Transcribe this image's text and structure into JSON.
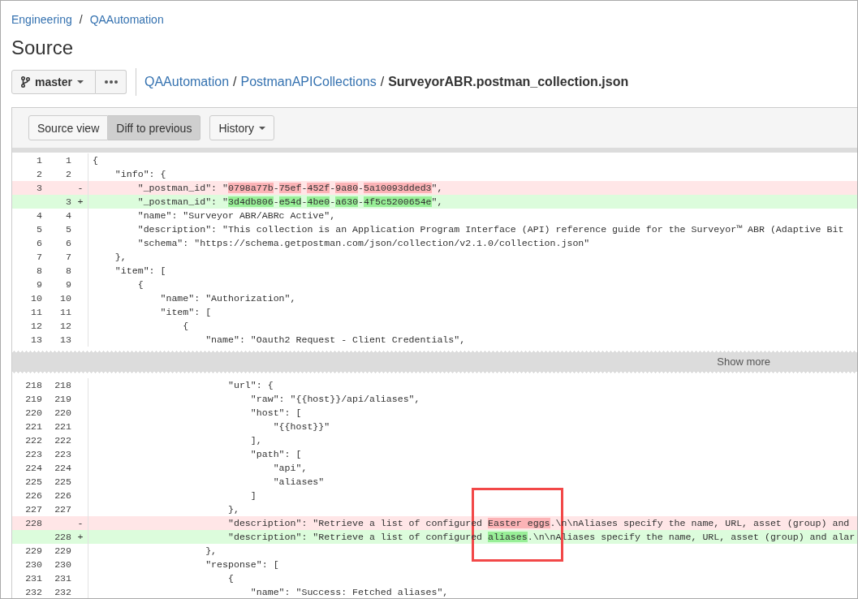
{
  "breadcrumbs": [
    {
      "kind": "link",
      "text": "Engineering"
    },
    {
      "kind": "separator",
      "text": "/"
    },
    {
      "kind": "link",
      "text": "QAAutomation"
    }
  ],
  "page_title": "Source",
  "branch_button": {
    "label": "master"
  },
  "file_path": [
    {
      "kind": "link",
      "text": "QAAutomation"
    },
    {
      "kind": "separator",
      "text": "/"
    },
    {
      "kind": "link",
      "text": "PostmanAPICollections"
    },
    {
      "kind": "separator",
      "text": "/"
    },
    {
      "kind": "current",
      "text": "SurveyorABR.postman_collection.json"
    }
  ],
  "view_toggle": [
    {
      "label": "Source view",
      "selected": false
    },
    {
      "label": "Diff to previous",
      "selected": true
    }
  ],
  "history_button": {
    "label": "History"
  },
  "diff": [
    {
      "kind": "hunk",
      "lines": [
        {
          "kind": "context",
          "old": "1",
          "new": "1",
          "code": "{"
        },
        {
          "kind": "context",
          "old": "2",
          "new": "2",
          "code": "    \"info\": {"
        },
        {
          "kind": "removed",
          "old": "3",
          "sign": "-",
          "segments": [
            {
              "text": "        \"_postman_id\": \"",
              "changed": false
            },
            {
              "text": "0798a77b",
              "changed": true
            },
            {
              "text": "-",
              "changed": false
            },
            {
              "text": "75ef",
              "changed": true
            },
            {
              "text": "-",
              "changed": false
            },
            {
              "text": "452f",
              "changed": true
            },
            {
              "text": "-",
              "changed": false
            },
            {
              "text": "9a80",
              "changed": true
            },
            {
              "text": "-",
              "changed": false
            },
            {
              "text": "5a10093dded3",
              "changed": true
            },
            {
              "text": "\",",
              "changed": false
            }
          ]
        },
        {
          "kind": "added",
          "new": "3",
          "sign": "+",
          "segments": [
            {
              "text": "        \"_postman_id\": \"",
              "changed": false
            },
            {
              "text": "3d4db806",
              "changed": true
            },
            {
              "text": "-",
              "changed": false
            },
            {
              "text": "e54d",
              "changed": true
            },
            {
              "text": "-",
              "changed": false
            },
            {
              "text": "4be0",
              "changed": true
            },
            {
              "text": "-",
              "changed": false
            },
            {
              "text": "a630",
              "changed": true
            },
            {
              "text": "-",
              "changed": false
            },
            {
              "text": "4f5c5200654e",
              "changed": true
            },
            {
              "text": "\",",
              "changed": false
            }
          ]
        },
        {
          "kind": "context",
          "old": "4",
          "new": "4",
          "code": "        \"name\": \"Surveyor ABR/ABRc Active\","
        },
        {
          "kind": "context",
          "old": "5",
          "new": "5",
          "code": "        \"description\": \"This collection is an Application Program Interface (API) reference guide for the Surveyor™ ABR (Adaptive Bit"
        },
        {
          "kind": "context",
          "old": "6",
          "new": "6",
          "code": "        \"schema\": \"https://schema.getpostman.com/json/collection/v2.1.0/collection.json\""
        },
        {
          "kind": "context",
          "old": "7",
          "new": "7",
          "code": "    },"
        },
        {
          "kind": "context",
          "old": "8",
          "new": "8",
          "code": "    \"item\": ["
        },
        {
          "kind": "context",
          "old": "9",
          "new": "9",
          "code": "        {"
        },
        {
          "kind": "context",
          "old": "10",
          "new": "10",
          "code": "            \"name\": \"Authorization\","
        },
        {
          "kind": "context",
          "old": "11",
          "new": "11",
          "code": "            \"item\": ["
        },
        {
          "kind": "context",
          "old": "12",
          "new": "12",
          "code": "                {"
        },
        {
          "kind": "context",
          "old": "13",
          "new": "13",
          "code": "                    \"name\": \"Oauth2 Request - Client Credentials\","
        }
      ]
    },
    {
      "kind": "collapsed",
      "label": "Show more"
    },
    {
      "kind": "hunk",
      "lines": [
        {
          "kind": "context",
          "old": "218",
          "new": "218",
          "code": "                        \"url\": {"
        },
        {
          "kind": "context",
          "old": "219",
          "new": "219",
          "code": "                            \"raw\": \"{{host}}/api/aliases\","
        },
        {
          "kind": "context",
          "old": "220",
          "new": "220",
          "code": "                            \"host\": ["
        },
        {
          "kind": "context",
          "old": "221",
          "new": "221",
          "code": "                                \"{{host}}\""
        },
        {
          "kind": "context",
          "old": "222",
          "new": "222",
          "code": "                            ],"
        },
        {
          "kind": "context",
          "old": "223",
          "new": "223",
          "code": "                            \"path\": ["
        },
        {
          "kind": "context",
          "old": "224",
          "new": "224",
          "code": "                                \"api\","
        },
        {
          "kind": "context",
          "old": "225",
          "new": "225",
          "code": "                                \"aliases\""
        },
        {
          "kind": "context",
          "old": "226",
          "new": "226",
          "code": "                            ]"
        },
        {
          "kind": "context",
          "old": "227",
          "new": "227",
          "code": "                        },"
        },
        {
          "kind": "removed",
          "old": "228",
          "sign": "-",
          "segments": [
            {
              "text": "                        \"description\": \"Retrieve a list of configured ",
              "changed": false
            },
            {
              "text": "Easter eggs",
              "changed": true
            },
            {
              "text": ".\\n\\nAliases specify the name, URL, asset (group) and",
              "changed": false
            }
          ]
        },
        {
          "kind": "added",
          "new": "228",
          "sign": "+",
          "segments": [
            {
              "text": "                        \"description\": \"Retrieve a list of configured ",
              "changed": false
            },
            {
              "text": "aliases",
              "changed": true
            },
            {
              "text": ".\\n\\nAliases specify the name, URL, asset (group) and alar",
              "changed": false
            }
          ]
        },
        {
          "kind": "context",
          "old": "229",
          "new": "229",
          "code": "                    },"
        },
        {
          "kind": "context",
          "old": "230",
          "new": "230",
          "code": "                    \"response\": ["
        },
        {
          "kind": "context",
          "old": "231",
          "new": "231",
          "code": "                        {"
        },
        {
          "kind": "context",
          "old": "232",
          "new": "232",
          "code": "                            \"name\": \"Success: Fetched aliases\","
        }
      ]
    }
  ],
  "annotation": {
    "kind": "rectangle"
  }
}
